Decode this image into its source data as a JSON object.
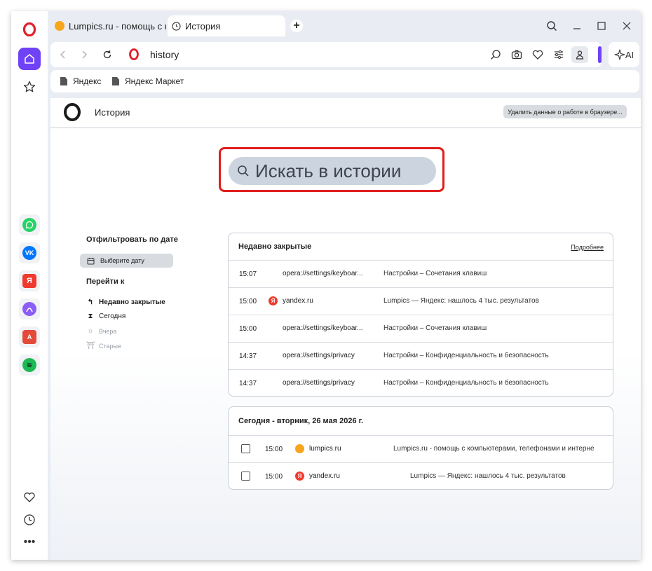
{
  "tabs": [
    {
      "title": "Lumpics.ru - помощь с ко",
      "favicon": "lumpics-icon"
    },
    {
      "title": "История",
      "favicon": "clock-icon"
    }
  ],
  "address": {
    "url": "history"
  },
  "ai_label": "AI",
  "bookmarks": [
    "Яндекс",
    "Яндекс Маркет"
  ],
  "page": {
    "title": "История",
    "clear_button": "Удалить данные о работе в браузере..."
  },
  "search": {
    "placeholder": "Искать в истории"
  },
  "filter": {
    "label": "Отфильтровать по дате",
    "date_button": "Выберите дату",
    "goto_label": "Перейти к",
    "goto_items": [
      "Недавно закрытые",
      "Сегодня",
      "Вчера",
      "Старые"
    ]
  },
  "recently_closed": {
    "title": "Недавно закрытые",
    "more": "Подробнее",
    "rows": [
      {
        "time": "15:07",
        "site": "opera://settings/keyboar...",
        "desc": "Настройки – Сочетания клавиш",
        "icon": "gear-icon"
      },
      {
        "time": "15:00",
        "site": "yandex.ru",
        "desc": "Lumpics — Яндекс: нашлось 4 тыс. результатов",
        "icon": "yandex-icon"
      },
      {
        "time": "15:00",
        "site": "opera://settings/keyboar...",
        "desc": "Настройки – Сочетания клавиш",
        "icon": "gear-icon"
      },
      {
        "time": "14:37",
        "site": "opera://settings/privacy",
        "desc": "Настройки – Конфиденциальность и безопасность",
        "icon": "gear-icon"
      },
      {
        "time": "14:37",
        "site": "opera://settings/privacy",
        "desc": "Настройки – Конфиденциальность и безопасность",
        "icon": "gear-icon"
      }
    ]
  },
  "today": {
    "title": "Сегодня - вторник, 26 мая 2026 г.",
    "rows": [
      {
        "time": "15:00",
        "site": "lumpics.ru",
        "desc": "Lumpics.ru - помощь с компьютерами, телефонами и интерне",
        "icon": "lumpics-icon"
      },
      {
        "time": "15:00",
        "site": "yandex.ru",
        "desc": "Lumpics — Яндекс: нашлось 4 тыс. результатов",
        "icon": "yandex-icon"
      }
    ]
  },
  "colors": {
    "accent": "#6f42f5",
    "highlight": "#e11d1d",
    "yandex": "#f03a2e",
    "lumpics": "#f7a51c"
  }
}
